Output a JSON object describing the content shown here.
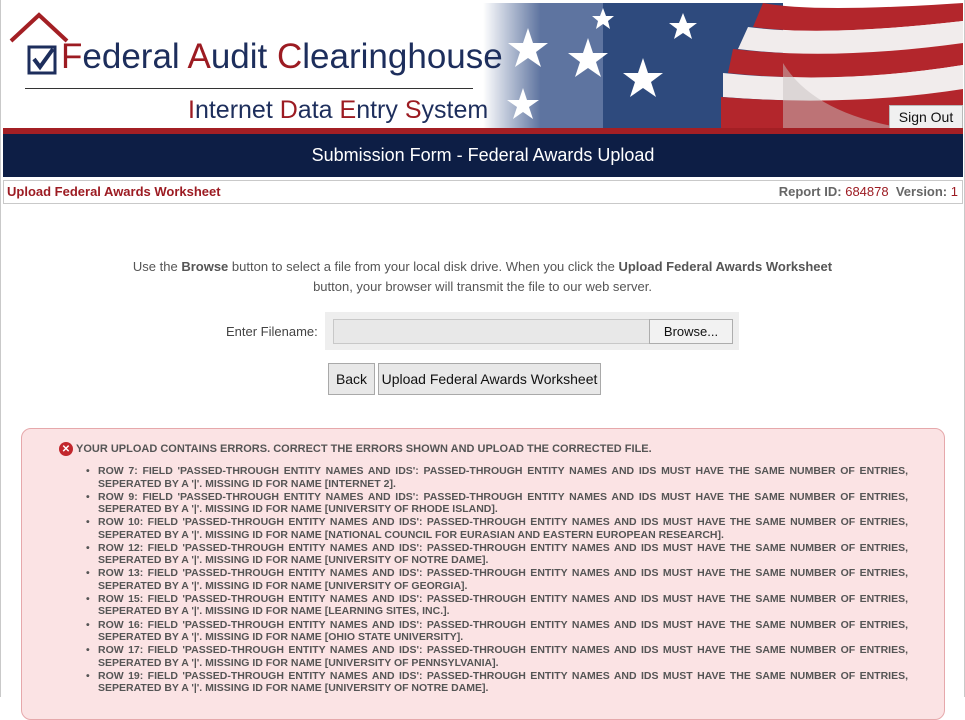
{
  "header": {
    "title_parts": [
      {
        "cap": "F",
        "rest": "ederal "
      },
      {
        "cap": "A",
        "rest": "udit "
      },
      {
        "cap": "C",
        "rest": "learinghouse"
      }
    ],
    "subtitle_parts": [
      {
        "cap": "I",
        "rest": "nternet "
      },
      {
        "cap": "D",
        "rest": "ata "
      },
      {
        "cap": "E",
        "rest": "ntry "
      },
      {
        "cap": "S",
        "rest": "ystem"
      }
    ],
    "sign_out_label": "Sign Out",
    "logo_icon": "house-checkbox-icon",
    "brand_colors": {
      "navy": "#0d1e45",
      "red": "#a31f24"
    }
  },
  "page_title": "Submission Form - Federal Awards Upload",
  "info_bar": {
    "section_title": "Upload Federal Awards Worksheet",
    "report_id_label": "Report ID:",
    "report_id_value": "684878",
    "version_label": "Version:",
    "version_value": "1"
  },
  "instructions": {
    "p1": "Use the ",
    "b1": "Browse",
    "p2": " button to select a file from your local disk drive. When you click the ",
    "b2": "Upload Federal Awards Worksheet",
    "p3": " button, your browser will transmit the file to our web server."
  },
  "file_input": {
    "label": "Enter Filename:",
    "value": "",
    "browse_label": "Browse..."
  },
  "buttons": {
    "back_label": "Back",
    "upload_label": "Upload Federal Awards Worksheet"
  },
  "errors": {
    "heading": "YOUR UPLOAD CONTAINS ERRORS. CORRECT THE ERRORS SHOWN AND UPLOAD THE CORRECTED FILE.",
    "items": [
      "ROW 7: FIELD 'PASSED-THROUGH ENTITY NAMES AND IDS': PASSED-THROUGH ENTITY NAMES AND IDS MUST HAVE THE SAME NUMBER OF ENTRIES, SEPERATED BY A '|'. MISSING ID FOR NAME [INTERNET 2].",
      "ROW 9: FIELD 'PASSED-THROUGH ENTITY NAMES AND IDS': PASSED-THROUGH ENTITY NAMES AND IDS MUST HAVE THE SAME NUMBER OF ENTRIES, SEPERATED BY A '|'. MISSING ID FOR NAME [UNIVERSITY OF RHODE ISLAND].",
      "ROW 10: FIELD 'PASSED-THROUGH ENTITY NAMES AND IDS': PASSED-THROUGH ENTITY NAMES AND IDS MUST HAVE THE SAME NUMBER OF ENTRIES, SEPERATED BY A '|'. MISSING ID FOR NAME [NATIONAL COUNCIL FOR EURASIAN AND EASTERN EUROPEAN RESEARCH].",
      "ROW 12: FIELD 'PASSED-THROUGH ENTITY NAMES AND IDS': PASSED-THROUGH ENTITY NAMES AND IDS MUST HAVE THE SAME NUMBER OF ENTRIES, SEPERATED BY A '|'. MISSING ID FOR NAME [UNIVERSITY OF NOTRE DAME].",
      "ROW 13: FIELD 'PASSED-THROUGH ENTITY NAMES AND IDS': PASSED-THROUGH ENTITY NAMES AND IDS MUST HAVE THE SAME NUMBER OF ENTRIES, SEPERATED BY A '|'. MISSING ID FOR NAME [UNIVERSITY OF GEORGIA].",
      "ROW 15: FIELD 'PASSED-THROUGH ENTITY NAMES AND IDS': PASSED-THROUGH ENTITY NAMES AND IDS MUST HAVE THE SAME NUMBER OF ENTRIES, SEPERATED BY A '|'. MISSING ID FOR NAME [LEARNING SITES, INC.].",
      "ROW 16: FIELD 'PASSED-THROUGH ENTITY NAMES AND IDS': PASSED-THROUGH ENTITY NAMES AND IDS MUST HAVE THE SAME NUMBER OF ENTRIES, SEPERATED BY A '|'. MISSING ID FOR NAME [OHIO STATE UNIVERSITY].",
      "ROW 17: FIELD 'PASSED-THROUGH ENTITY NAMES AND IDS': PASSED-THROUGH ENTITY NAMES AND IDS MUST HAVE THE SAME NUMBER OF ENTRIES, SEPERATED BY A '|'. MISSING ID FOR NAME [UNIVERSITY OF PENNSYLVANIA].",
      "ROW 19: FIELD 'PASSED-THROUGH ENTITY NAMES AND IDS': PASSED-THROUGH ENTITY NAMES AND IDS MUST HAVE THE SAME NUMBER OF ENTRIES, SEPERATED BY A '|'. MISSING ID FOR NAME [UNIVERSITY OF NOTRE DAME]."
    ],
    "error_icon": "error-x-icon"
  }
}
